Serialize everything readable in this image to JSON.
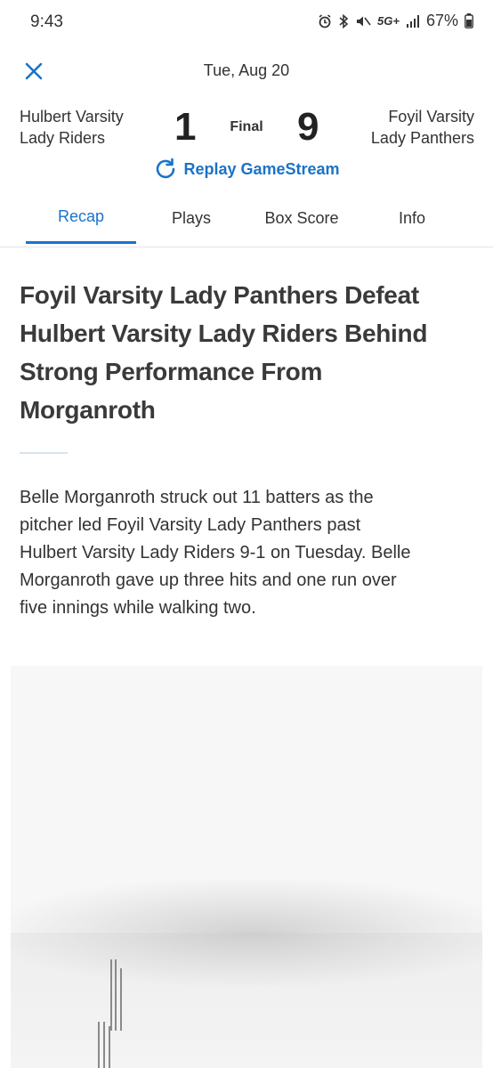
{
  "status_bar": {
    "time": "9:43",
    "network": "5G+",
    "battery": "67%"
  },
  "header": {
    "date": "Tue, Aug 20",
    "home_team": {
      "line1": "Hulbert Varsity",
      "line2": "Lady Riders",
      "score": "1"
    },
    "away_team": {
      "line1": "Foyil Varsity",
      "line2": "Lady Panthers",
      "score": "9"
    },
    "status": "Final",
    "replay_label": "Replay GameStream"
  },
  "tabs": [
    {
      "label": "Recap",
      "active": true
    },
    {
      "label": "Plays",
      "active": false
    },
    {
      "label": "Box Score",
      "active": false
    },
    {
      "label": "Info",
      "active": false
    }
  ],
  "article": {
    "headline_lines": [
      "Foyil Varsity Lady Panthers Defeat",
      "Hulbert Varsity Lady Riders Behind",
      "Strong Performance From",
      "Morganroth"
    ],
    "summary_lines": [
      "Belle Morganroth struck out 11 batters as the",
      "pitcher led Foyil Varsity Lady Panthers past",
      "Hulbert Varsity Lady Riders 9-1 on Tuesday. Belle",
      "Morganroth gave up three hits and one run over",
      "five innings while walking two."
    ]
  },
  "colors": {
    "accent": "#1a73c8",
    "text": "#333333"
  }
}
